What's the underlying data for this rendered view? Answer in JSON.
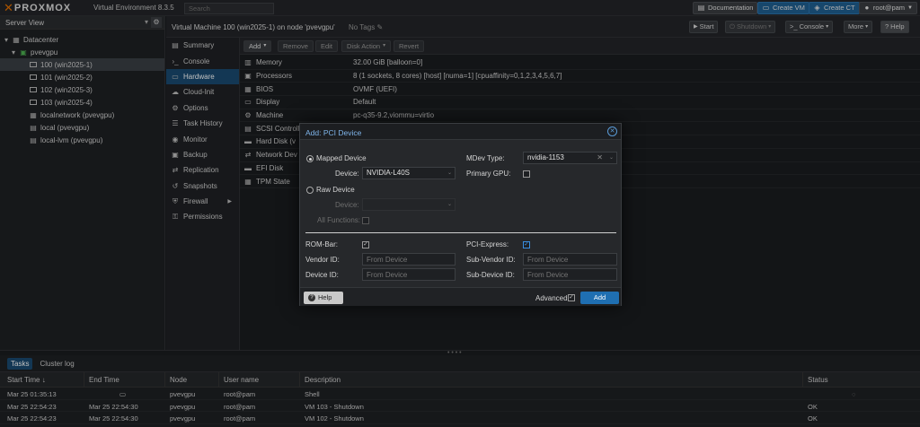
{
  "topbar": {
    "brand": "PROXMOX",
    "subtitle": "Virtual Environment 8.3.5",
    "search_placeholder": "Search",
    "documentation": "Documentation",
    "create_vm": "Create VM",
    "create_ct": "Create CT",
    "user": "root@pam"
  },
  "tree": {
    "view": "Server View",
    "items": [
      {
        "label": "Datacenter"
      },
      {
        "label": "pvevgpu"
      },
      {
        "label": "100 (win2025-1)"
      },
      {
        "label": "101 (win2025-2)"
      },
      {
        "label": "102 (win2025-3)"
      },
      {
        "label": "103 (win2025-4)"
      },
      {
        "label": "localnetwork (pvevgpu)"
      },
      {
        "label": "local (pvevgpu)"
      },
      {
        "label": "local-lvm (pvevgpu)"
      }
    ]
  },
  "header": {
    "title": "Virtual Machine 100 (win2025-1) on node 'pvevgpu'",
    "tags": "No Tags",
    "start": "Start",
    "shutdown": "Shutdown",
    "console": "Console",
    "more": "More",
    "help": "Help"
  },
  "submenu": {
    "items": [
      {
        "label": "Summary"
      },
      {
        "label": "Console"
      },
      {
        "label": "Hardware"
      },
      {
        "label": "Cloud-Init"
      },
      {
        "label": "Options"
      },
      {
        "label": "Task History"
      },
      {
        "label": "Monitor"
      },
      {
        "label": "Backup"
      },
      {
        "label": "Replication"
      },
      {
        "label": "Snapshots"
      },
      {
        "label": "Firewall"
      },
      {
        "label": "Permissions"
      }
    ]
  },
  "hwtoolbar": {
    "add": "Add",
    "remove": "Remove",
    "edit": "Edit",
    "disk_action": "Disk Action",
    "revert": "Revert"
  },
  "hardware": [
    {
      "name": "Memory",
      "value": "32.00 GiB [balloon=0]"
    },
    {
      "name": "Processors",
      "value": "8 (1 sockets, 8 cores) [host] [numa=1] [cpuaffinity=0,1,2,3,4,5,6,7]"
    },
    {
      "name": "BIOS",
      "value": "OVMF (UEFI)"
    },
    {
      "name": "Display",
      "value": "Default"
    },
    {
      "name": "Machine",
      "value": "pc-q35-9.2,viommu=virtio"
    },
    {
      "name": "SCSI Controller",
      "value": ""
    },
    {
      "name": "Hard Disk (v",
      "value": ""
    },
    {
      "name": "Network Dev",
      "value": ""
    },
    {
      "name": "EFI Disk",
      "value": ""
    },
    {
      "name": "TPM State",
      "value": ""
    }
  ],
  "dialog": {
    "title": "Add: PCI Device",
    "mapped_device": "Mapped Device",
    "device_label": "Device:",
    "device_value": "NVIDIA-L40S",
    "raw_device": "Raw Device",
    "raw_device_label": "Device:",
    "all_functions": "All Functions:",
    "mdev_type_label": "MDev Type:",
    "mdev_type_value": "nvidia-1153",
    "primary_gpu": "Primary GPU:",
    "rom_bar": "ROM-Bar:",
    "pci_express": "PCI-Express:",
    "vendor_id": "Vendor ID:",
    "sub_vendor_id": "Sub-Vendor ID:",
    "device_id": "Device ID:",
    "sub_device_id": "Sub-Device ID:",
    "from_device": "From Device",
    "help": "Help",
    "advanced": "Advanced",
    "add": "Add"
  },
  "tasks": {
    "tabs": [
      "Tasks",
      "Cluster log"
    ],
    "columns": [
      "Start Time",
      "End Time",
      "Node",
      "User name",
      "Description",
      "Status"
    ],
    "rows": [
      {
        "start": "Mar 25 01:35:13",
        "end": "",
        "node": "pvevgpu",
        "user": "root@pam",
        "desc": "Shell",
        "status": ""
      },
      {
        "start": "Mar 25 22:54:23",
        "end": "Mar 25 22:54:30",
        "node": "pvevgpu",
        "user": "root@pam",
        "desc": "VM 103 - Shutdown",
        "status": "OK"
      },
      {
        "start": "Mar 25 22:54:23",
        "end": "Mar 25 22:54:30",
        "node": "pvevgpu",
        "user": "root@pam",
        "desc": "VM 102 - Shutdown",
        "status": "OK"
      }
    ]
  }
}
